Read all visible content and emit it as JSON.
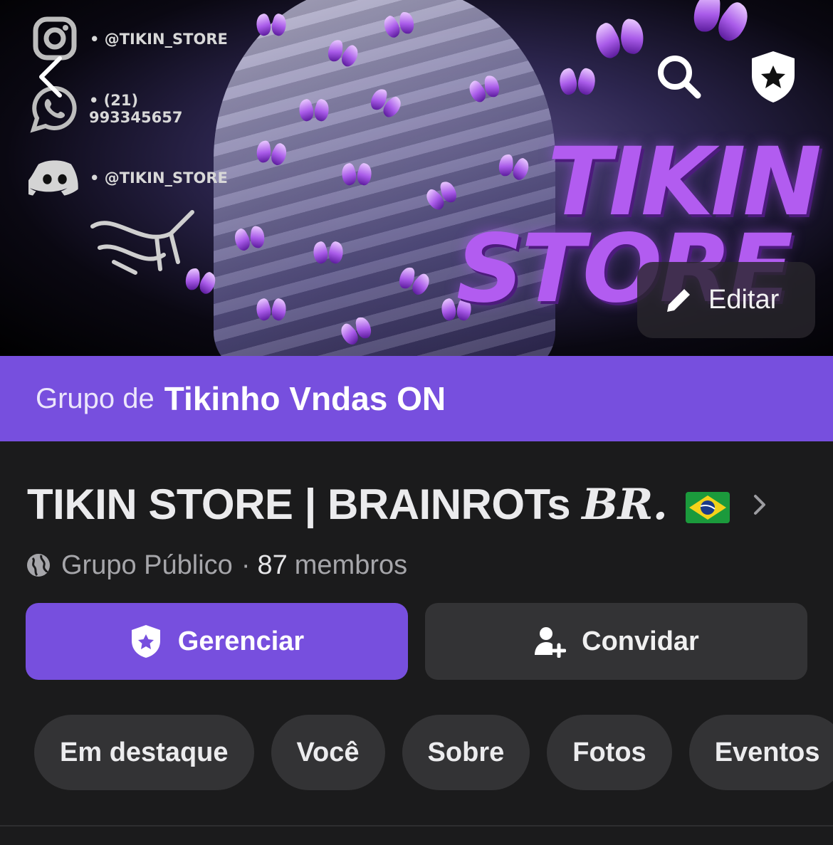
{
  "cover": {
    "contacts": [
      {
        "icon": "instagram-icon",
        "text": "• @TIKIN_STORE"
      },
      {
        "icon": "whatsapp-icon",
        "text": "• (21) 993345657"
      },
      {
        "icon": "discord-icon",
        "text": "• @TIKIN_STORE"
      }
    ],
    "brand_line1": "TIKIN",
    "brand_line2": "STORE",
    "edit_label": "Editar"
  },
  "owner_banner": {
    "prefix": "Grupo de",
    "owner_name": "Tikinho Vndas ON"
  },
  "group": {
    "title_main": "TIKIN STORE | BRAINROTs ",
    "title_styled": "BR.",
    "privacy": "Grupo Público",
    "separator": "·",
    "member_count": "87",
    "member_label": "membros"
  },
  "actions": {
    "manage_label": "Gerenciar",
    "invite_label": "Convidar"
  },
  "tabs": [
    "Em destaque",
    "Você",
    "Sobre",
    "Fotos",
    "Eventos"
  ],
  "colors": {
    "accent": "#774fde",
    "background": "#1b1b1c",
    "button_secondary": "#333335"
  }
}
